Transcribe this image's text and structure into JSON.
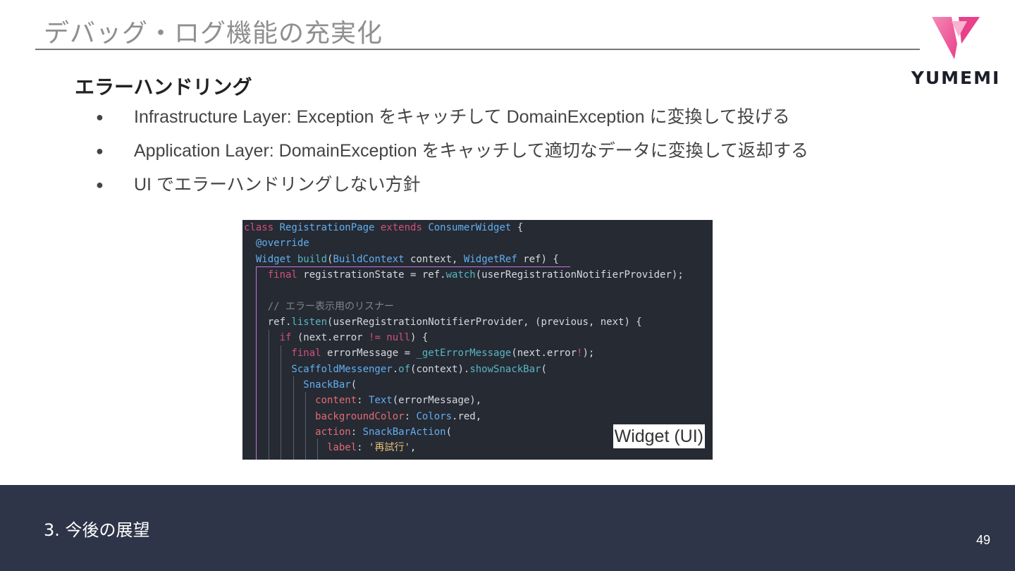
{
  "slide": {
    "title": "デバッグ・ログ機能の充実化",
    "heading": "エラーハンドリング",
    "bullets": [
      {
        "marker": "●",
        "text": "Infrastructure Layer: Exception をキャッチして DomainException に変換して投げる"
      },
      {
        "marker": "●",
        "text": "Application Layer: DomainException をキャッチして適切なデータに変換して返却する"
      },
      {
        "marker": "●",
        "text": "UI でエラーハンドリングしない方針"
      }
    ],
    "badge": "Widget (UI)",
    "footer": "3. 今後の展望",
    "page_number": "49"
  },
  "logo": {
    "text": "YUMEMI",
    "icon": "yumemi-logo-mark",
    "colors": [
      "#e8408a",
      "#f48ab5"
    ]
  },
  "code": {
    "lines": [
      [
        {
          "t": "class ",
          "c": "kw"
        },
        {
          "t": "RegistrationPage ",
          "c": "ty"
        },
        {
          "t": "extends ",
          "c": "kw"
        },
        {
          "t": "ConsumerWidget",
          "c": "ty"
        },
        {
          "t": " {",
          "c": ""
        }
      ],
      [
        {
          "t": "  @override",
          "c": "an"
        }
      ],
      [
        {
          "t": "  Widget ",
          "c": "ty"
        },
        {
          "t": "build",
          "c": "fn"
        },
        {
          "t": "(",
          "c": ""
        },
        {
          "t": "BuildContext",
          "c": "ty"
        },
        {
          "t": " context, ",
          "c": ""
        },
        {
          "t": "WidgetRef",
          "c": "ty"
        },
        {
          "t": " ref) {",
          "c": ""
        }
      ],
      [
        {
          "t": "    final ",
          "c": "kw"
        },
        {
          "t": "registrationState = ref.",
          "c": ""
        },
        {
          "t": "watch",
          "c": "fn"
        },
        {
          "t": "(userRegistrationNotifierProvider);",
          "c": ""
        }
      ],
      [
        {
          "t": "",
          "c": ""
        }
      ],
      [
        {
          "t": "    // エラー表示用のリスナー",
          "c": "cm"
        }
      ],
      [
        {
          "t": "    ref.",
          "c": ""
        },
        {
          "t": "listen",
          "c": "fn"
        },
        {
          "t": "(userRegistrationNotifierProvider, (previous, next) {",
          "c": ""
        }
      ],
      [
        {
          "t": "      if ",
          "c": "kw"
        },
        {
          "t": "(next.error ",
          "c": ""
        },
        {
          "t": "!= null",
          "c": "kw"
        },
        {
          "t": ") {",
          "c": ""
        }
      ],
      [
        {
          "t": "        final ",
          "c": "kw"
        },
        {
          "t": "errorMessage = ",
          "c": ""
        },
        {
          "t": "_getErrorMessage",
          "c": "fn"
        },
        {
          "t": "(next.error",
          "c": ""
        },
        {
          "t": "!",
          "c": "kw"
        },
        {
          "t": ");",
          "c": ""
        }
      ],
      [
        {
          "t": "        ScaffoldMessenger",
          "c": "ty"
        },
        {
          "t": ".",
          "c": ""
        },
        {
          "t": "of",
          "c": "fn"
        },
        {
          "t": "(context).",
          "c": ""
        },
        {
          "t": "showSnackBar",
          "c": "fn"
        },
        {
          "t": "(",
          "c": ""
        }
      ],
      [
        {
          "t": "          SnackBar",
          "c": "ty"
        },
        {
          "t": "(",
          "c": ""
        }
      ],
      [
        {
          "t": "            content",
          "c": "pr"
        },
        {
          "t": ": ",
          "c": ""
        },
        {
          "t": "Text",
          "c": "ty"
        },
        {
          "t": "(errorMessage),",
          "c": ""
        }
      ],
      [
        {
          "t": "            backgroundColor",
          "c": "pr"
        },
        {
          "t": ": ",
          "c": ""
        },
        {
          "t": "Colors",
          "c": "ty"
        },
        {
          "t": ".red,",
          "c": ""
        }
      ],
      [
        {
          "t": "            action",
          "c": "pr"
        },
        {
          "t": ": ",
          "c": ""
        },
        {
          "t": "SnackBarAction",
          "c": "ty"
        },
        {
          "t": "(",
          "c": ""
        }
      ],
      [
        {
          "t": "              label",
          "c": "pr"
        },
        {
          "t": ": ",
          "c": ""
        },
        {
          "t": "'再試行'",
          "c": "st"
        },
        {
          "t": ",",
          "c": ""
        }
      ]
    ]
  }
}
